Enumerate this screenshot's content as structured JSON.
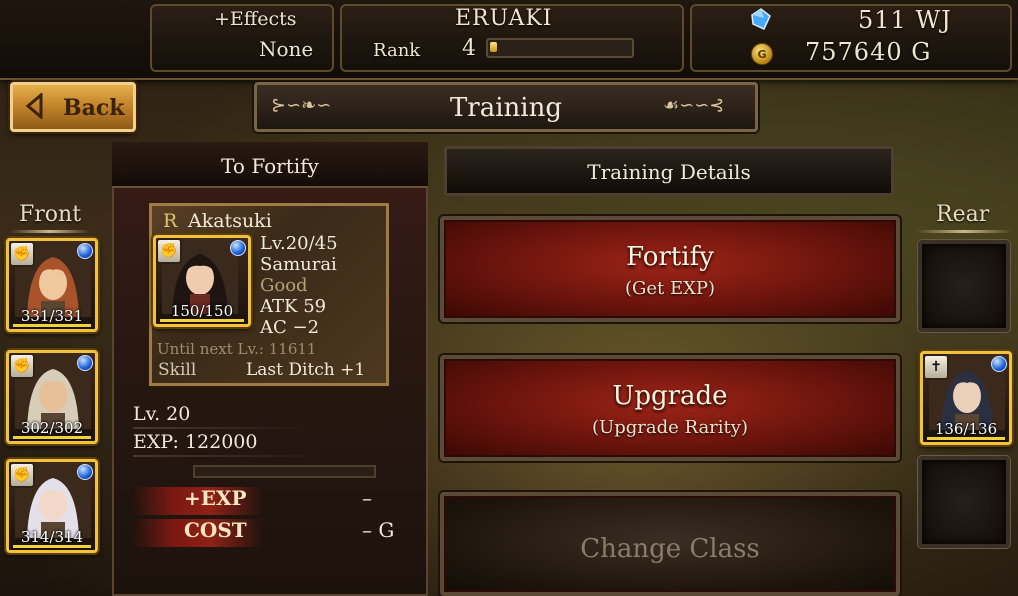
{
  "header": {
    "effects_label": "+Effects",
    "effects_value": "None",
    "player_name": "ERUAKI",
    "rank_label": "Rank",
    "rank_value": "4",
    "rank_progress": 0.05,
    "wj_value": "511 WJ",
    "gold_icon_letter": "G",
    "gold_value": "757640 G"
  },
  "nav": {
    "back_label": "Back",
    "title": "Training"
  },
  "party": {
    "front_label": "Front",
    "rear_label": "Rear",
    "front": [
      {
        "hp": "331/331",
        "hair": "#a8532a",
        "skin": "#f0c8a0"
      },
      {
        "hp": "302/302",
        "hair": "#d8cdb8",
        "skin": "#e7bf98"
      },
      {
        "hp": "314/314",
        "hair": "#e4e0ea",
        "skin": "#f2d8c8"
      }
    ],
    "rear": [
      {
        "empty": true
      },
      {
        "hp": "136/136",
        "hair": "#2a3040",
        "skin": "#ead0b8",
        "badge": "✝"
      },
      {
        "empty": true
      }
    ]
  },
  "fortify": {
    "title": "To Fortify",
    "unit": {
      "rarity": "R",
      "name": "Akatsuki",
      "level": "Lv.20/45",
      "class": "Samurai",
      "condition": "Good",
      "atk": "ATK 59",
      "ac": "AC  −2",
      "hp": "150/150",
      "until_next": "Until next Lv.: 11611",
      "skill_label": "Skill",
      "skill_value": "Last Ditch +1"
    },
    "level_line": "Lv.  20",
    "exp_line": "EXP: 122000",
    "plus_exp_label": "+EXP",
    "plus_exp_value": "–",
    "cost_label": "COST",
    "cost_value": "– G"
  },
  "details": {
    "title": "Training Details",
    "fortify_main": "Fortify",
    "fortify_sub": "(Get EXP)",
    "upgrade_main": "Upgrade",
    "upgrade_sub": "(Upgrade Rarity)",
    "change_class": "Change Class"
  },
  "colors": {
    "gold_frame": "#f4c23a",
    "button_red": "#9e2418",
    "gem_blue": "#1b5fd6"
  }
}
